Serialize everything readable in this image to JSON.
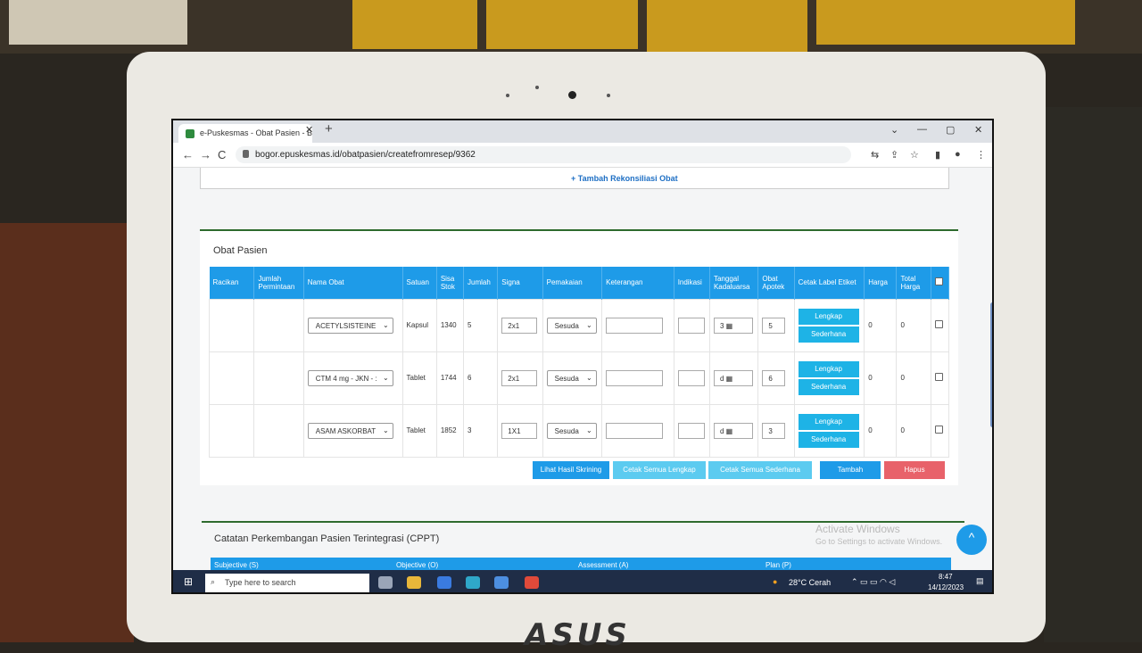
{
  "browser": {
    "tab_title": "e-Puskesmas - Obat Pasien - Bu",
    "tab_close": "✕",
    "new_tab": "+",
    "url": "bogor.epuskesmas.id/obatpasien/createfromresep/9362",
    "win_min": "—",
    "win_max": "▢",
    "win_close": "✕",
    "nav_back": "←",
    "nav_forward": "→",
    "nav_reload": "C"
  },
  "page": {
    "rekonsiliasi_link": "+ Tambah Rekonsiliasi Obat",
    "section_title": "Obat Pasien",
    "columns": [
      "Racikan",
      "Jumlah Permintaan",
      "Nama Obat",
      "Satuan",
      "Sisa Stok",
      "Jumlah",
      "Signa",
      "Pemakaian",
      "Keterangan",
      "Indikasi",
      "Tanggal Kadaluarsa",
      "Obat Apotek",
      "Cetak Label Etiket",
      "Harga",
      "Total Harga"
    ],
    "rows": [
      {
        "nama_obat": "ACETYLSISTEINE",
        "satuan": "Kapsul",
        "sisa_stok": "1340",
        "jumlah": "5",
        "signa": "2x1",
        "pemakaian": "Sesuda",
        "tanggal": "3",
        "obat_apotek": "5",
        "btn_lengkap": "Lengkap",
        "btn_sederhana": "Sederhana",
        "harga": "0",
        "total_harga": "0"
      },
      {
        "nama_obat": "CTM 4 mg - JKN - :",
        "satuan": "Tablet",
        "sisa_stok": "1744",
        "jumlah": "6",
        "signa": "2x1",
        "pemakaian": "Sesuda",
        "tanggal": "d",
        "obat_apotek": "6",
        "btn_lengkap": "Lengkap",
        "btn_sederhana": "Sederhana",
        "harga": "0",
        "total_harga": "0"
      },
      {
        "nama_obat": "ASAM ASKORBAT",
        "satuan": "Tablet",
        "sisa_stok": "1852",
        "jumlah": "3",
        "signa": "1X1",
        "pemakaian": "Sesuda",
        "tanggal": "d",
        "obat_apotek": "3",
        "btn_lengkap": "Lengkap",
        "btn_sederhana": "Sederhana",
        "harga": "0",
        "total_harga": "0"
      }
    ],
    "actions": {
      "lihat": "Lihat Hasil Skrining",
      "cetak_lengkap": "Cetak Semua Lengkap",
      "cetak_sederhana": "Cetak Semua Sederhana",
      "tambah": "Tambah",
      "hapus": "Hapus"
    },
    "cppt_title": "Catatan Perkembangan Pasien Terintegrasi (CPPT)",
    "cppt_columns": [
      "Subjective (S)",
      "Objective (O)",
      "Assessment (A)",
      "Plan (P)"
    ],
    "activate_title": "Activate Windows",
    "activate_sub": "Go to Settings to activate Windows."
  },
  "taskbar": {
    "search_placeholder": "Type here to search",
    "weather": "28°C  Cerah",
    "time": "8:47",
    "date": "14/12/2023"
  },
  "colors": {
    "header_blue": "#1e9be8",
    "button_cyan": "#1eb3e6",
    "hapus_red": "#e8626a",
    "divider_green": "#2e6b2e"
  }
}
